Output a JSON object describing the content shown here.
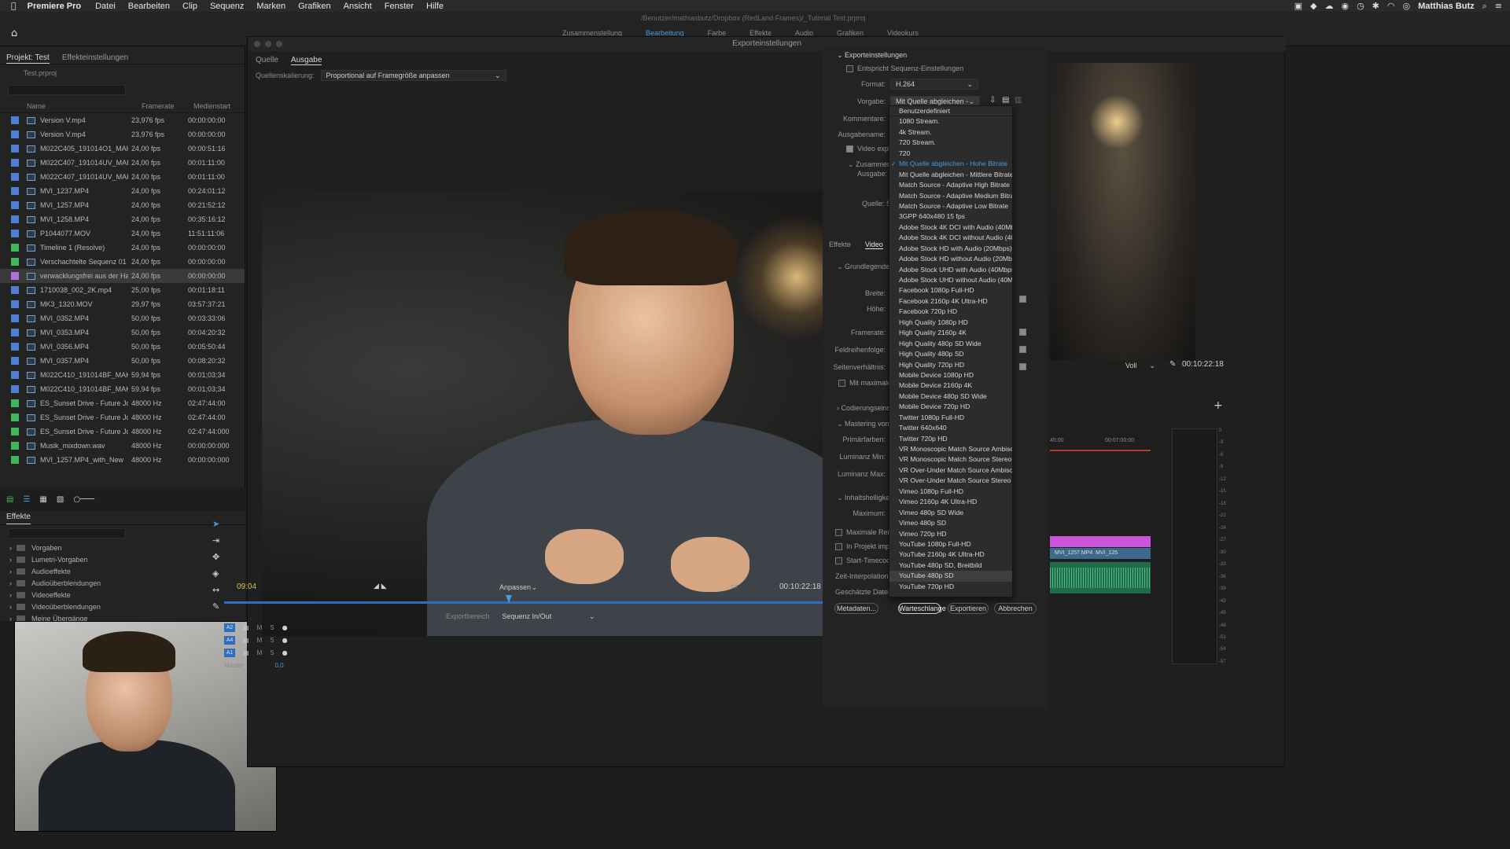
{
  "menubar": {
    "apple_icon": "apple-icon",
    "app_name": "Premiere Pro",
    "items": [
      "Datei",
      "Bearbeiten",
      "Clip",
      "Sequenz",
      "Marken",
      "Grafiken",
      "Ansicht",
      "Fenster",
      "Hilfe"
    ],
    "user": "Matthias Butz"
  },
  "app": {
    "file_path": "/Benutzer/mathiasbutz/Dropbox (RedLand Frames)/_Tutorial Test.prproj",
    "workspace_tabs": [
      "Zusammenstellung",
      "Bearbeitung",
      "Farbe",
      "Effekte",
      "Audio",
      "Grafiken",
      "Videokurs"
    ],
    "active_workspace": "Bearbeitung"
  },
  "project": {
    "tabs": [
      "Projekt: Test",
      "Effekteinstellungen"
    ],
    "file": "Test.prproj",
    "columns": [
      "Name",
      "Framerate",
      "Medienstart"
    ],
    "rows": [
      {
        "color": "#4f7fd1",
        "name": "Version V.mp4",
        "fps": "23,976 fps",
        "start": "00:00:00:00"
      },
      {
        "color": "#4f7fd1",
        "name": "Version V.mp4",
        "fps": "23,976 fps",
        "start": "00:00:00:00"
      },
      {
        "color": "#4f7fd1",
        "name": "M022C405_191014O1_MAK",
        "fps": "24,00 fps",
        "start": "00:00:51:16"
      },
      {
        "color": "#4f7fd1",
        "name": "M022C407_191014UV_MAK",
        "fps": "24,00 fps",
        "start": "00:01:11:00"
      },
      {
        "color": "#4f7fd1",
        "name": "M022C407_191014UV_MAK",
        "fps": "24,00 fps",
        "start": "00:01:11:00"
      },
      {
        "color": "#4f7fd1",
        "name": "MVI_1237.MP4",
        "fps": "24,00 fps",
        "start": "00:24:01:12"
      },
      {
        "color": "#4f7fd1",
        "name": "MVI_1257.MP4",
        "fps": "24,00 fps",
        "start": "00:21:52:12"
      },
      {
        "color": "#4f7fd1",
        "name": "MVI_1258.MP4",
        "fps": "24,00 fps",
        "start": "00:35:16:12"
      },
      {
        "color": "#4f7fd1",
        "name": "P1044077.MOV",
        "fps": "24,00 fps",
        "start": "11:51:11:06"
      },
      {
        "color": "#3db85a",
        "name": "Timeline 1 (Resolve)",
        "fps": "24,00 fps",
        "start": "00:00:00:00"
      },
      {
        "color": "#3db85a",
        "name": "Verschachtelte Sequenz 01",
        "fps": "24,00 fps",
        "start": "00:00:00:00"
      },
      {
        "color": "#b070d8",
        "name": "verwacklungsfrei aus der Ha",
        "fps": "24,00 fps",
        "start": "00:00:00:00"
      },
      {
        "color": "#4f7fd1",
        "name": "1710038_002_2K.mp4",
        "fps": "25,00 fps",
        "start": "00:01:18:11"
      },
      {
        "color": "#4f7fd1",
        "name": "MK3_1320.MOV",
        "fps": "29,97 fps",
        "start": "03:57:37:21"
      },
      {
        "color": "#4f7fd1",
        "name": "MVI_0352.MP4",
        "fps": "50,00 fps",
        "start": "00:03:33:06"
      },
      {
        "color": "#4f7fd1",
        "name": "MVI_0353.MP4",
        "fps": "50,00 fps",
        "start": "00:04:20:32"
      },
      {
        "color": "#4f7fd1",
        "name": "MVI_0356.MP4",
        "fps": "50,00 fps",
        "start": "00:05:50:44"
      },
      {
        "color": "#4f7fd1",
        "name": "MVI_0357.MP4",
        "fps": "50,00 fps",
        "start": "00:08:20:32"
      },
      {
        "color": "#4f7fd1",
        "name": "M022C410_191014BF_MAK",
        "fps": "59,94 fps",
        "start": "00:01;03;34"
      },
      {
        "color": "#4f7fd1",
        "name": "M022C410_191014BF_MAK",
        "fps": "59,94 fps",
        "start": "00:01;03;34"
      },
      {
        "color": "#3db85a",
        "name": "ES_Sunset Drive - Future Jou",
        "fps": "48000  Hz",
        "start": "02:47:44:00"
      },
      {
        "color": "#3db85a",
        "name": "ES_Sunset Drive - Future Jou",
        "fps": "48000  Hz",
        "start": "02:47:44:00"
      },
      {
        "color": "#3db85a",
        "name": "ES_Sunset Drive - Future Jou",
        "fps": "48000  Hz",
        "start": "02:47:44:000"
      },
      {
        "color": "#3db85a",
        "name": "Musik_mixdown.wav",
        "fps": "48000  Hz",
        "start": "00:00:00:000"
      },
      {
        "color": "#3db85a",
        "name": "MVI_1257.MP4_with_New",
        "fps": "48000  Hz",
        "start": "00:00:00:000"
      }
    ],
    "selected_row": 11
  },
  "effects": {
    "tab": "Effekte",
    "items": [
      "Vorgaben",
      "Lumetri-Vorgaben",
      "Audioeffekte",
      "Audioüberblendungen",
      "Videoeffekte",
      "Videoüberblendungen",
      "Meine Übergänge"
    ]
  },
  "dialog": {
    "title": "Exporteinstellungen",
    "source_tabs": [
      "Quelle",
      "Ausgabe"
    ],
    "active_source_tab": "Ausgabe",
    "scaling_label": "Quellenskalierung:",
    "scaling_value": "Proportional auf Framegröße anpassen",
    "timecode_left": "09:04",
    "timecode_right": "00:10:22:18",
    "fit_value": "Anpassen",
    "range_label": "Exportbereich",
    "range_value": "Sequenz In/Out"
  },
  "settings": {
    "section_export": "Exporteinstellungen",
    "match_sequence": "Entspricht Sequenz-Einstellungen",
    "format_label": "Format:",
    "format_value": "H.264",
    "preset_label": "Vorgabe:",
    "preset_value": "Mit Quelle abgleichen - Hohe Bit...",
    "comment_label": "Kommentare:",
    "output_label": "Ausgabename:",
    "video_export": "Video exportie",
    "summary": "Zusammenfa",
    "summary_output": "Ausgabe: /U",
    "summary_source": "Quelle: Se",
    "tabs": [
      "Effekte",
      "Video",
      "A"
    ],
    "active_tab": "Video",
    "basic_video": "Grundlegende Vi",
    "width_label": "Breite:",
    "height_label": "Höhe:",
    "framerate_label": "Framerate:",
    "field_label": "Feldreihenfolge:",
    "aspect_label": "Seitenverhältnis:",
    "max_depth": "Mit maximaler Ti",
    "encoding": "Codierungseinste",
    "mastering": "Mastering von A",
    "primaries": "Primärfarben:",
    "lum_min": "Luminanz Min:",
    "lum_max": "Luminanz Max:",
    "content_light": "Inhaltshelligkeit",
    "maximum": "Maximum:",
    "max_render": "Maximale Render-Q",
    "import_project": "In Projekt importier",
    "start_timecode": "Start-Timecode fest",
    "time_interp": "Zeit-Interpolation:",
    "file_size": "Geschätzte Dateigröße:",
    "btn_meta": "Metadaten...",
    "btn_queue": "Warteschlange",
    "btn_export": "Exportieren",
    "btn_cancel": "Abbrechen"
  },
  "preset_list": {
    "items": [
      "Benutzerdefiniert",
      "1080 Stream.",
      "4k Stream.",
      "720 Stream.",
      "720",
      "Mit Quelle abgleichen - Hohe Bitrate",
      "Mit Quelle abgleichen - Mittlere Bitrate",
      "Match Source - Adaptive High Bitrate",
      "Match Source - Adaptive Medium Bitrate",
      "Match Source - Adaptive Low Bitrate",
      "3GPP 640x480 15 fps",
      "Adobe Stock 4K DCI with Audio (40Mbps)",
      "Adobe Stock 4K DCI without Audio (40Mbps)",
      "Adobe Stock HD with Audio (20Mbps)",
      "Adobe Stock HD without Audio (20Mbps)",
      "Adobe Stock UHD with Audio (40Mbps)",
      "Adobe Stock UHD without Audio (40Mbps)",
      "Facebook 1080p Full-HD",
      "Facebook 2160p 4K Ultra-HD",
      "Facebook 720p HD",
      "High Quality 1080p HD",
      "High Quality 2160p 4K",
      "High Quality 480p SD Wide",
      "High Quality 480p SD",
      "High Quality 720p HD",
      "Mobile Device 1080p HD",
      "Mobile Device 2160p 4K",
      "Mobile Device 480p SD Wide",
      "Mobile Device 720p HD",
      "Twitter 1080p Full-HD",
      "Twitter 640x640",
      "Twitter 720p HD",
      "VR Monoscopic Match Source Ambisonics",
      "VR Monoscopic Match Source Stereo Audio",
      "VR Over-Under Match Source Ambisonics",
      "VR Over-Under Match Source Stereo Audio",
      "Vimeo 1080p Full-HD",
      "Vimeo 2160p 4K Ultra-HD",
      "Vimeo 480p SD Wide",
      "Vimeo 480p SD",
      "Vimeo 720p HD",
      "YouTube 1080p Full-HD",
      "YouTube 2160p 4K Ultra-HD",
      "YouTube 480p SD, Breitbild",
      "YouTube 480p SD",
      "YouTube 720p HD"
    ],
    "checked_index": 5,
    "hover_index": 44
  },
  "program": {
    "zoom": "Voll",
    "timecode": "00:10:22:18",
    "ruler_a": "45:00",
    "ruler_b": "00:07:00:00",
    "clip_label": "MVI_1257.MP4",
    "clip_label_2": "MVI_125"
  },
  "tracks": {
    "rows": [
      "A2",
      "A4",
      "A1"
    ],
    "master_label": "Master",
    "master_value": "0,0"
  },
  "colors": {
    "accent": "#4a9ad8",
    "timecode_yellow": "#d8c04a",
    "clip_pink": "#c956d6",
    "audio_green": "#1f6b4b"
  }
}
